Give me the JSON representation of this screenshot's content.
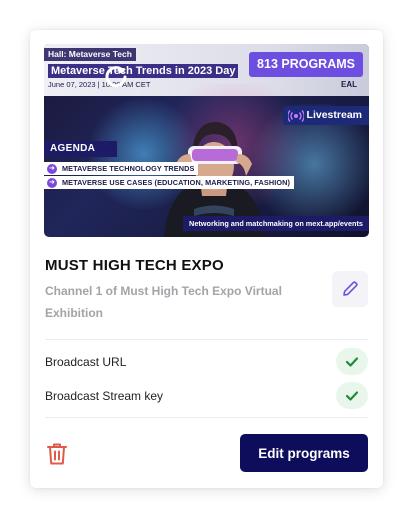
{
  "card": {
    "banner": {
      "hall_tag": "Hall: Metaverse Tech",
      "title": "Metaverse Tech Trends in 2023 Day",
      "date": "June 07, 2023 | 10:00 AM CET",
      "sponsor_logo_text": "EAL",
      "programs_count_label": "813 PROGRAMS",
      "livestream_label": "Livestream",
      "agenda_label": "AGENDA",
      "agenda_items": [
        "METAVERSE TECHNOLOGY TRENDS",
        "METAVERSE USE CASES (EDUCATION, MARKETING, FASHION)"
      ],
      "footer_text": "Networking and matchmaking on mext.app/events"
    },
    "title": "MUST HIGH TECH EXPO",
    "subtitle": "Channel 1 of Must High Tech Expo Virtual Exhibition",
    "rows": [
      {
        "label": "Broadcast URL",
        "status_icon": "check-icon"
      },
      {
        "label": "Broadcast Stream key",
        "status_icon": "check-icon"
      }
    ],
    "actions": {
      "delete_icon": "trash-icon",
      "edit_icon": "pencil-icon",
      "edit_programs_label": "Edit programs"
    }
  },
  "colors": {
    "accent_purple": "#6c4ee0",
    "primary_button": "#0e0d5c",
    "check_green": "#1e8a3a",
    "check_bg": "#e8f6ec",
    "delete_red": "#e05a48",
    "subtitle_gray": "#a3a3a8"
  }
}
